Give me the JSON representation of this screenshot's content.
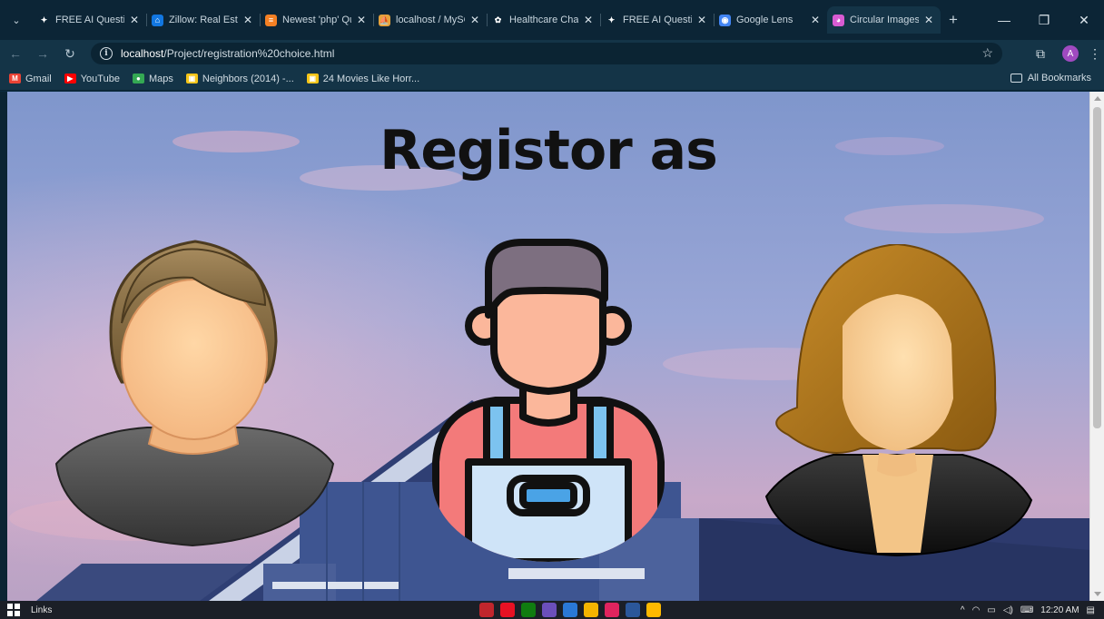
{
  "browser": {
    "tabs": [
      {
        "title": "FREE AI Questio",
        "icon_color": "#0c2536",
        "icon_glyph": "✦",
        "active": false
      },
      {
        "title": "Zillow: Real Esta",
        "icon_color": "#1277e1",
        "icon_glyph": "⌂",
        "active": false
      },
      {
        "title": "Newest 'php' Qu",
        "icon_color": "#f48024",
        "icon_glyph": "≡",
        "active": false
      },
      {
        "title": "localhost / MySC",
        "icon_color": "#e6a23c",
        "icon_glyph": "⛵",
        "active": false
      },
      {
        "title": "Healthcare Chat",
        "icon_color": "#0c2536",
        "icon_glyph": "✿",
        "active": false
      },
      {
        "title": "FREE AI Questio",
        "icon_color": "#0c2536",
        "icon_glyph": "✦",
        "active": false
      },
      {
        "title": "Google Lens",
        "icon_color": "#4285f4",
        "icon_glyph": "◉",
        "active": false
      },
      {
        "title": "Circular Images",
        "icon_color": "#d85bd2",
        "icon_glyph": "◕",
        "active": true
      }
    ],
    "address": {
      "host": "localhost",
      "path": "/Project/registration%20choice.html"
    },
    "avatar_letter": "A",
    "bookmarks": [
      {
        "label": "Gmail",
        "icon_color": "#ea4335",
        "icon_glyph": "M"
      },
      {
        "label": "YouTube",
        "icon_color": "#ff0000",
        "icon_glyph": "▶"
      },
      {
        "label": "Maps",
        "icon_color": "#34a853",
        "icon_glyph": "●"
      },
      {
        "label": "Neighbors (2014) -...",
        "icon_color": "#f5c518",
        "icon_glyph": "▣"
      },
      {
        "label": "24 Movies Like Horr...",
        "icon_color": "#f5c518",
        "icon_glyph": "▣"
      }
    ],
    "all_bookmarks_label": "All Bookmarks"
  },
  "page": {
    "heading": "Registor as",
    "choices": [
      {
        "name": "male-user",
        "icon": "man-avatar-icon"
      },
      {
        "name": "worker",
        "icon": "worker-apron-icon"
      },
      {
        "name": "female-user",
        "icon": "woman-avatar-icon"
      }
    ]
  },
  "taskbar": {
    "links_label": "Links",
    "time": "12:20 AM"
  },
  "colors": {
    "tab_bar": "#0c2536",
    "toolbar": "#143447",
    "heading_text": "#111111"
  }
}
